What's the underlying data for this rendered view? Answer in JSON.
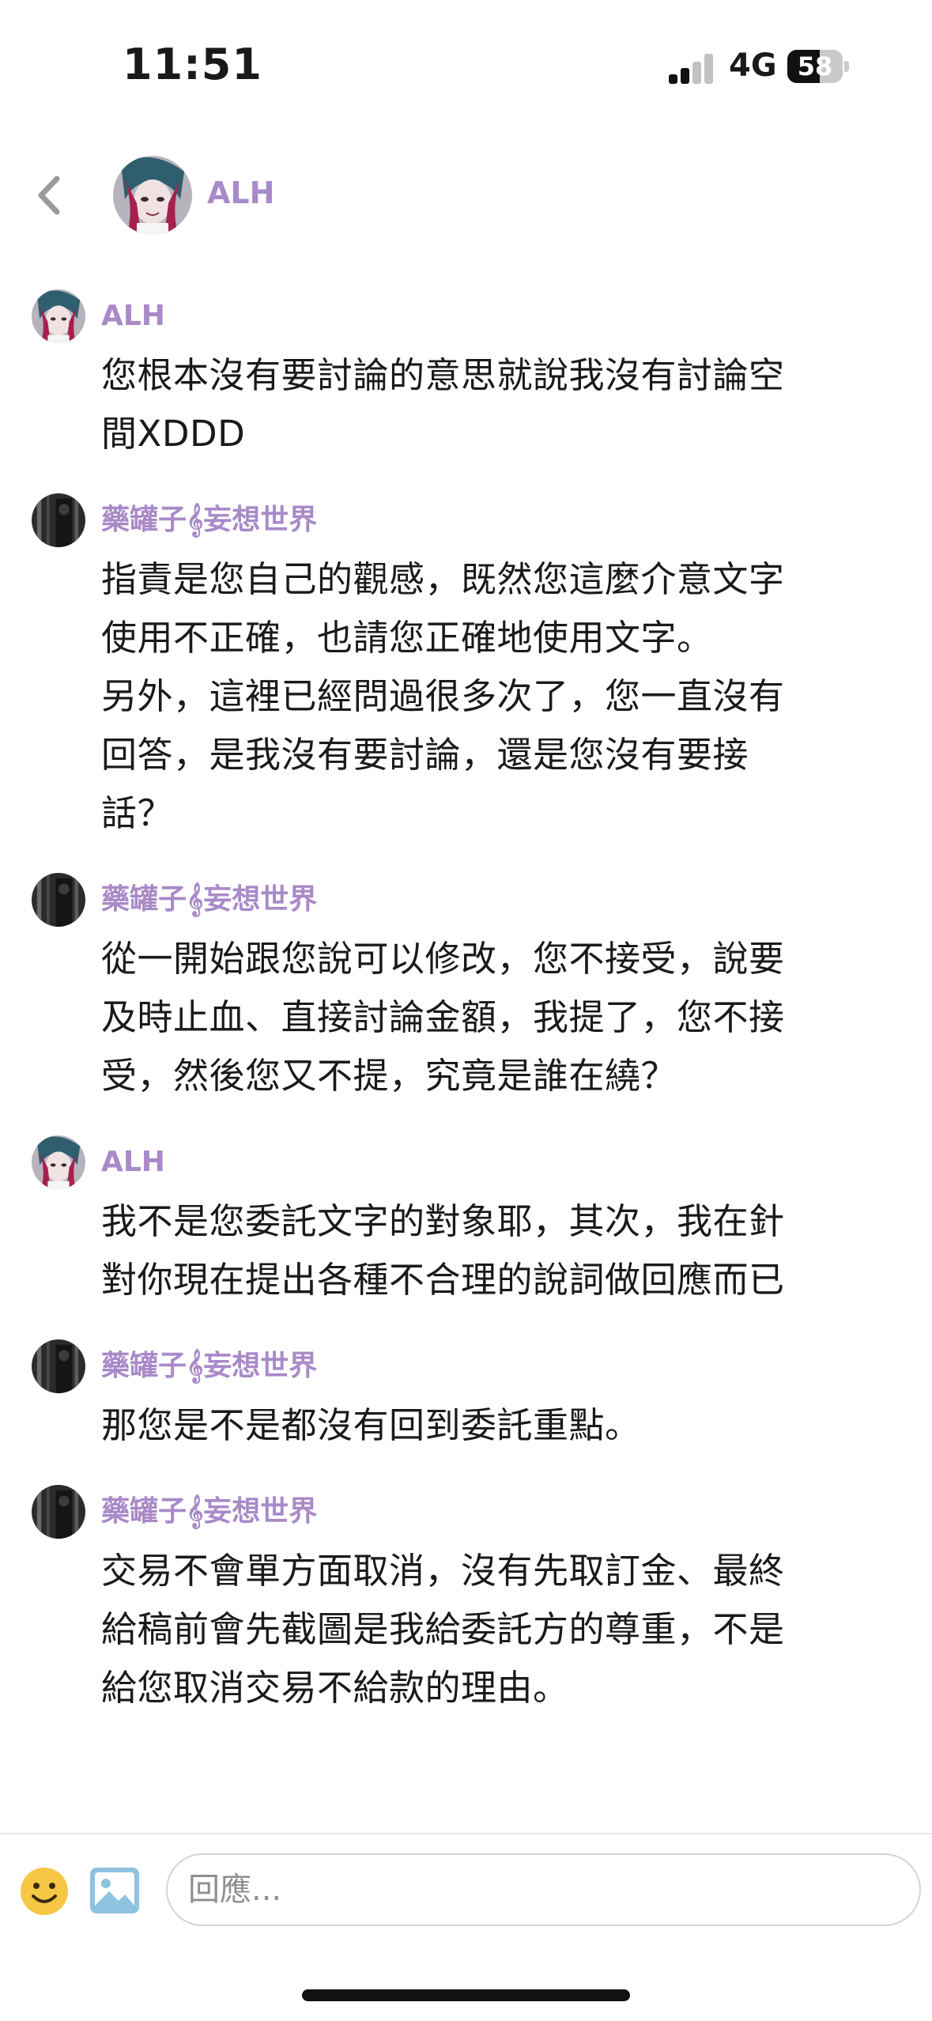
{
  "status_bar": {
    "time": "11:51",
    "network": "4G",
    "battery": "58",
    "battery_level_percent": 58,
    "signal_bars_active": 2,
    "signal_bars_total": 4
  },
  "header": {
    "back_icon": "chevron-left-icon",
    "name": "ALH"
  },
  "colors": {
    "sender_name": "#a98ac8",
    "text": "#1a1a1a",
    "divider": "#e6e6e6",
    "emoji_yellow": "#f6c744",
    "image_icon_blue": "#8fc3df"
  },
  "messages": [
    {
      "sender": "ALH",
      "avatar": "alh-avatar",
      "text": "您根本沒有要討論的意思就說我沒有討論空\n間XDDD"
    },
    {
      "sender": "藥罐子𝄞妄想世界",
      "avatar": "dark-avatar",
      "text": "指責是您自己的觀感，既然您這麼介意文字\n使用不正確，也請您正確地使用文字。\n另外，這裡已經問過很多次了，您一直沒有\n回答，是我沒有要討論，還是您沒有要接\n話？"
    },
    {
      "sender": "藥罐子𝄞妄想世界",
      "avatar": "dark-avatar",
      "text": "從一開始跟您說可以修改，您不接受，說要\n及時止血、直接討論金額，我提了，您不接\n受，然後您又不提，究竟是誰在繞？"
    },
    {
      "sender": "ALH",
      "avatar": "alh-avatar",
      "text": "我不是您委託文字的對象耶，其次，我在針\n對你現在提出各種不合理的說詞做回應而已"
    },
    {
      "sender": "藥罐子𝄞妄想世界",
      "avatar": "dark-avatar",
      "text": "那您是不是都沒有回到委託重點。"
    },
    {
      "sender": "藥罐子𝄞妄想世界",
      "avatar": "dark-avatar",
      "text": "交易不會單方面取消，沒有先取訂金、最終\n給稿前會先截圖是我給委託方的尊重，不是\n給您取消交易不給款的理由。"
    }
  ],
  "composer": {
    "emoji_icon": "emoji-icon",
    "image_icon": "image-icon",
    "placeholder": "回應..."
  }
}
